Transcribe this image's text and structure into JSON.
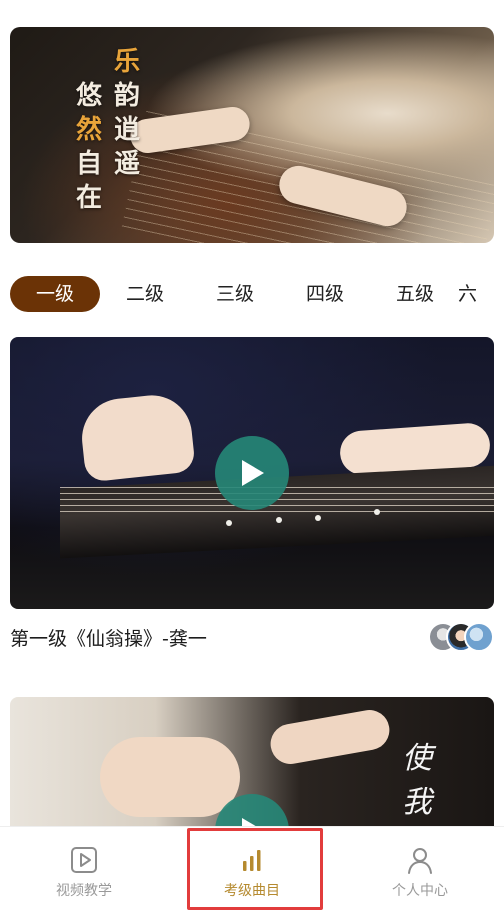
{
  "banner": {
    "poem_col1": [
      "悠",
      "然",
      "自",
      "在"
    ],
    "poem_col2": [
      "乐",
      "韵",
      "逍",
      "遥"
    ],
    "accent_color": "#e8a43a"
  },
  "level_tabs": [
    {
      "label": "一级",
      "active": true
    },
    {
      "label": "二级",
      "active": false
    },
    {
      "label": "三级",
      "active": false
    },
    {
      "label": "四级",
      "active": false
    },
    {
      "label": "五级",
      "active": false
    },
    {
      "label": "六",
      "active": false
    }
  ],
  "videos": [
    {
      "title": "第一级《仙翁操》-龚一",
      "icon": "play-icon"
    },
    {
      "title": "",
      "overlay_text": "使我",
      "icon": "play-icon"
    }
  ],
  "bottom_nav": {
    "items": [
      {
        "label": "视频教学",
        "icon": "video-play-icon",
        "active": false
      },
      {
        "label": "考级曲目",
        "icon": "bar-chart-icon",
        "active": true
      },
      {
        "label": "个人中心",
        "icon": "user-icon",
        "active": false
      }
    ],
    "active_color": "#b58a2f",
    "inactive_color": "#9a9a9a"
  },
  "colors": {
    "active_tab_bg": "#6b3306",
    "play_button": "#268778",
    "highlight_border": "#e23c3c"
  }
}
